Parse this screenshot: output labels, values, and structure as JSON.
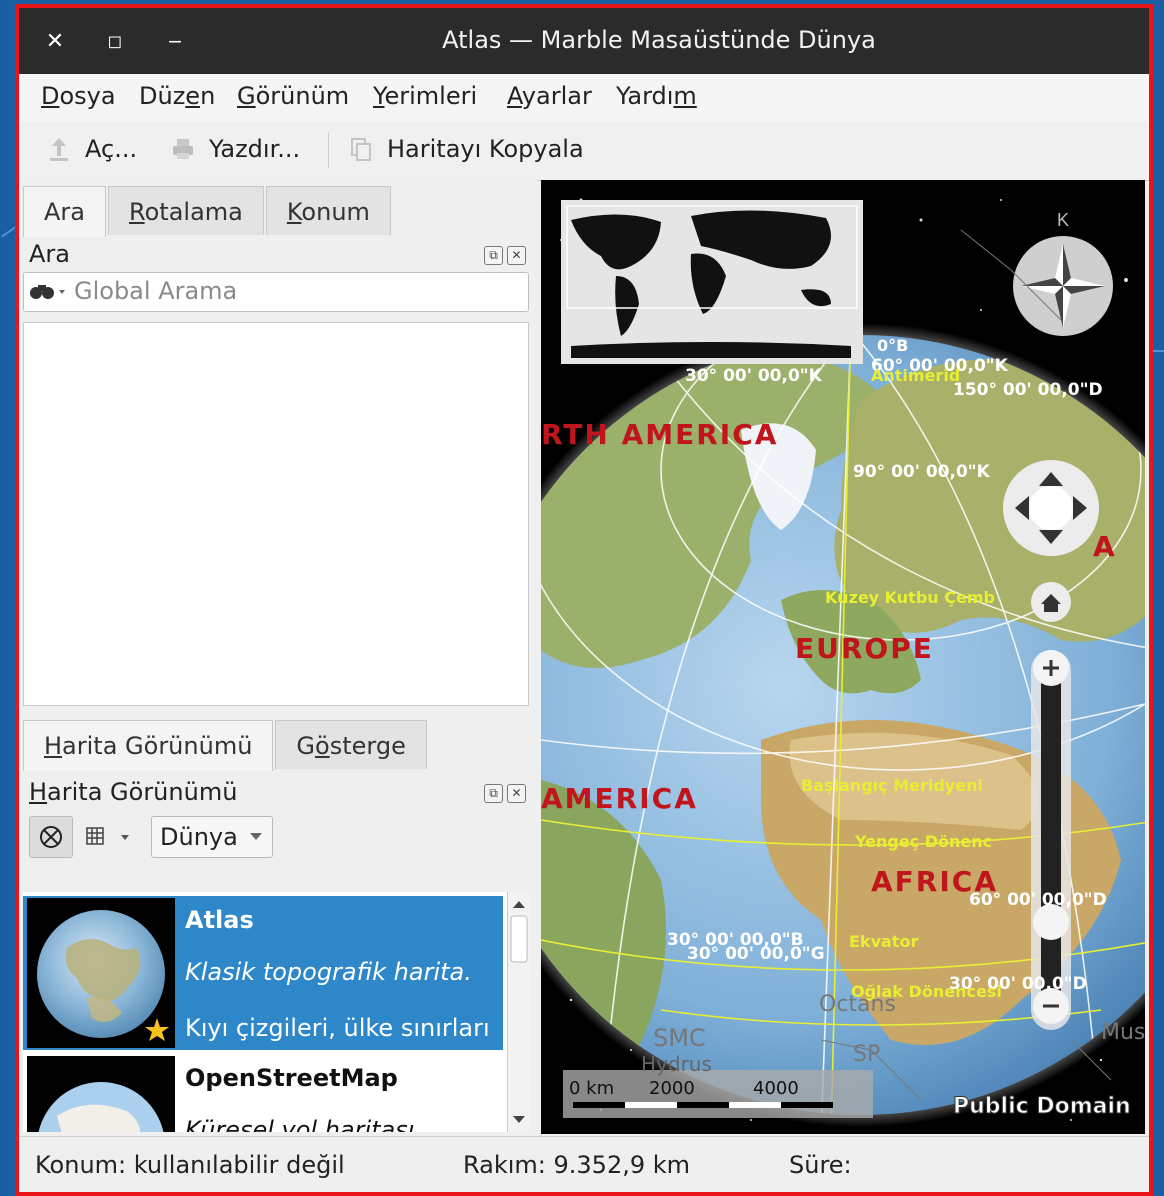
{
  "window": {
    "title": "Atlas — Marble Masaüstünde Dünya",
    "controls": {
      "close": "✕",
      "maximize": "◻",
      "minimize": "‒"
    }
  },
  "menu": [
    {
      "label": "Dosya",
      "accel": "D",
      "rest": "osya"
    },
    {
      "label": "Düzen",
      "pre": "Düz",
      "accel": "e",
      "rest": "n"
    },
    {
      "label": "Görünüm",
      "accel": "G",
      "rest": "örünüm"
    },
    {
      "label": "Yerimleri",
      "accel": "Y",
      "rest": "erimleri"
    },
    {
      "label": "Ayarlar",
      "accel": "A",
      "rest": "yarlar"
    },
    {
      "label": "Yardım",
      "pre": "Yardı",
      "accel": "m",
      "rest": ""
    }
  ],
  "toolbar": {
    "open_label": "Aç...",
    "print_label": "Yazdır...",
    "copy_label": "Haritayı Kopyala"
  },
  "left_tabs": {
    "search": "Ara",
    "routing": "Rotalama",
    "location": "Konum"
  },
  "search_panel": {
    "title": "Ara",
    "placeholder": "Global Arama"
  },
  "bottom_tabs": {
    "map_view": "Harita Görünümü",
    "legend": "Gösterge"
  },
  "map_view_panel": {
    "title": "Harita Görünümü",
    "celestial_body": "Dünya",
    "themes": [
      {
        "name": "Atlas",
        "desc": "Klasik topografik harita.",
        "desc2": "Kıyı çizgileri, ülke sınırları",
        "selected": true
      },
      {
        "name": "OpenStreetMap",
        "desc": "Küresel yol haritası",
        "selected": false
      }
    ]
  },
  "map": {
    "labels": {
      "north_america": "RTH AMERICA",
      "south_america": "AMERICA",
      "europe": "EUROPE",
      "africa": "AFRICA",
      "asia": "A"
    },
    "grid_labels": {
      "lat0": "0°B",
      "lon30k": "30° 00' 00,0\"K",
      "lat60k": "60° 00' 00,0\"K",
      "lon150d": "150° 00' 00,0\"D",
      "lat90k": "90° 00' 00,0\"K",
      "lat60d": "60° 00' 00,0\"D",
      "lon30b": "30° 00' 00,0\"B",
      "lon30g": "30° 00' 00,0\"G",
      "lat30d": "30° 00' 00,0\"D"
    },
    "circles": {
      "arctic": "Kuzey Kutbu Çemb",
      "prime_meridian": "Başlangıç Meridyeni",
      "cancer": "Yengeç Dönenc",
      "equator": "Ekvator",
      "capricorn": "Oğlak Dönencesi",
      "arctic_pre": "Antimerid"
    },
    "stars": {
      "octans": "Octans",
      "smc": "SMC",
      "hydrus": "Hydrus",
      "sp": "SP",
      "musca": "Musc"
    },
    "compass_north": "K",
    "scale": {
      "zero": "0 km",
      "mid": "2000",
      "end": "4000"
    },
    "attribution": "Public Domain"
  },
  "status": {
    "position": "Konum: kullanılabilir değil",
    "altitude": "Rakım:  9.352,9 km",
    "duration": "Süre:"
  },
  "colors": {
    "titlebar": "#2b2b2b",
    "selection": "#2e87c8",
    "window_border": "#e8161a",
    "continent_label": "#c0151c",
    "circle_label": "#f2f21a"
  }
}
